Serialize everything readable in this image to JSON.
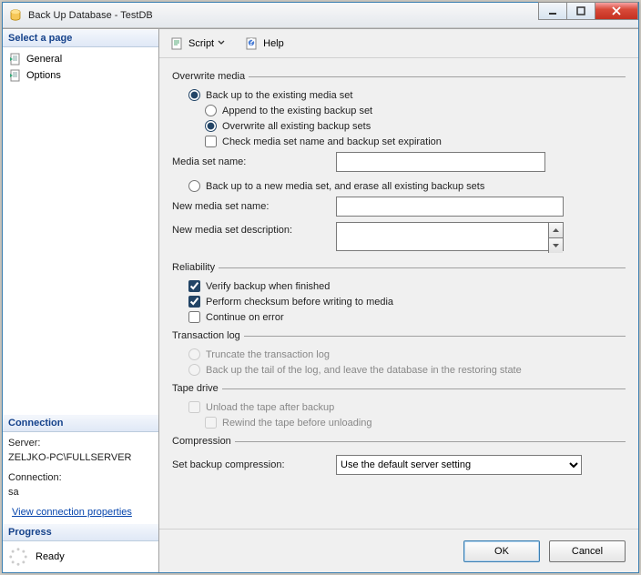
{
  "window": {
    "title": "Back Up Database - TestDB"
  },
  "sidebar": {
    "select_page_header": "Select a page",
    "items": [
      {
        "label": "General"
      },
      {
        "label": "Options"
      }
    ],
    "connection_header": "Connection",
    "server_label": "Server:",
    "server_value": "ZELJKO-PC\\FULLSERVER",
    "connection_label": "Connection:",
    "connection_value": "sa",
    "view_conn_props": "View connection properties",
    "progress_header": "Progress",
    "progress_value": "Ready"
  },
  "toolbar": {
    "script_label": "Script",
    "help_label": "Help"
  },
  "overwrite": {
    "legend": "Overwrite media",
    "radio_existing": "Back up to the existing media set",
    "radio_append": "Append to the existing backup set",
    "radio_overwrite_all": "Overwrite all existing backup sets",
    "check_media_name": "Check media set name and backup set expiration",
    "media_set_name_label": "Media set name:",
    "media_set_name_value": "",
    "radio_new_media": "Back up to a new media set, and erase all existing backup sets",
    "new_media_name_label": "New media set name:",
    "new_media_name_value": "",
    "new_media_desc_label": "New media set description:",
    "new_media_desc_value": ""
  },
  "reliability": {
    "legend": "Reliability",
    "verify": "Verify backup when finished",
    "checksum": "Perform checksum before writing to media",
    "continue": "Continue on error"
  },
  "txlog": {
    "legend": "Transaction log",
    "truncate": "Truncate the transaction log",
    "tail": "Back up the tail of the log, and leave the database in the restoring state"
  },
  "tape": {
    "legend": "Tape drive",
    "unload": "Unload the tape after backup",
    "rewind": "Rewind the tape before unloading"
  },
  "compression": {
    "legend": "Compression",
    "label": "Set backup compression:",
    "value": "Use the default server setting"
  },
  "buttons": {
    "ok": "OK",
    "cancel": "Cancel"
  }
}
